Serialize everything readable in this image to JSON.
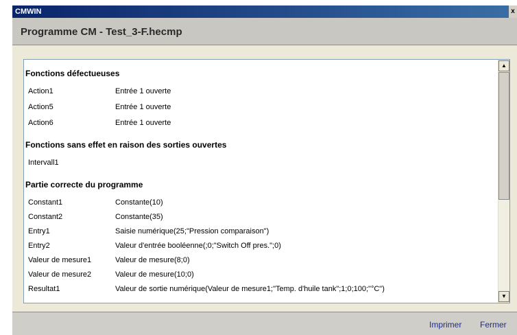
{
  "window": {
    "title": "CMWIN",
    "close_glyph": "x"
  },
  "header": {
    "title": "Programme CM - Test_3-F.hecmp"
  },
  "sections": {
    "defective": {
      "title": "Fonctions défectueuses",
      "rows": [
        {
          "name": "Action1",
          "value": "Entrée 1 ouverte"
        },
        {
          "name": "Action5",
          "value": "Entrée 1 ouverte"
        },
        {
          "name": "Action6",
          "value": "Entrée 1 ouverte"
        }
      ]
    },
    "no_effect": {
      "title": "Fonctions sans effet en raison des sorties ouvertes",
      "rows": [
        {
          "name": "Intervall1",
          "value": ""
        }
      ]
    },
    "correct": {
      "title": "Partie correcte du programme",
      "rows": [
        {
          "name": "Constant1",
          "value": "Constante(10)"
        },
        {
          "name": "Constant2",
          "value": "Constante(35)"
        },
        {
          "name": "Entry1",
          "value": "Saisie numérique(25;\"Pression comparaison\")"
        },
        {
          "name": "Entry2",
          "value": "Valeur d'entrée booléenne(;0;\"Switch Off pres.\";0)"
        },
        {
          "name": "Valeur de mesure1",
          "value": "Valeur de mesure(8;0)"
        },
        {
          "name": "Valeur de mesure2",
          "value": "Valeur de mesure(10;0)"
        },
        {
          "name": "Resultat1",
          "value": "Valeur de sortie numérique(Valeur de mesure1;\"Temp. d'huile tank\";1;0;100;\"°C\")"
        }
      ]
    }
  },
  "footer": {
    "print_label": "Imprimer",
    "close_label": "Fermer"
  }
}
